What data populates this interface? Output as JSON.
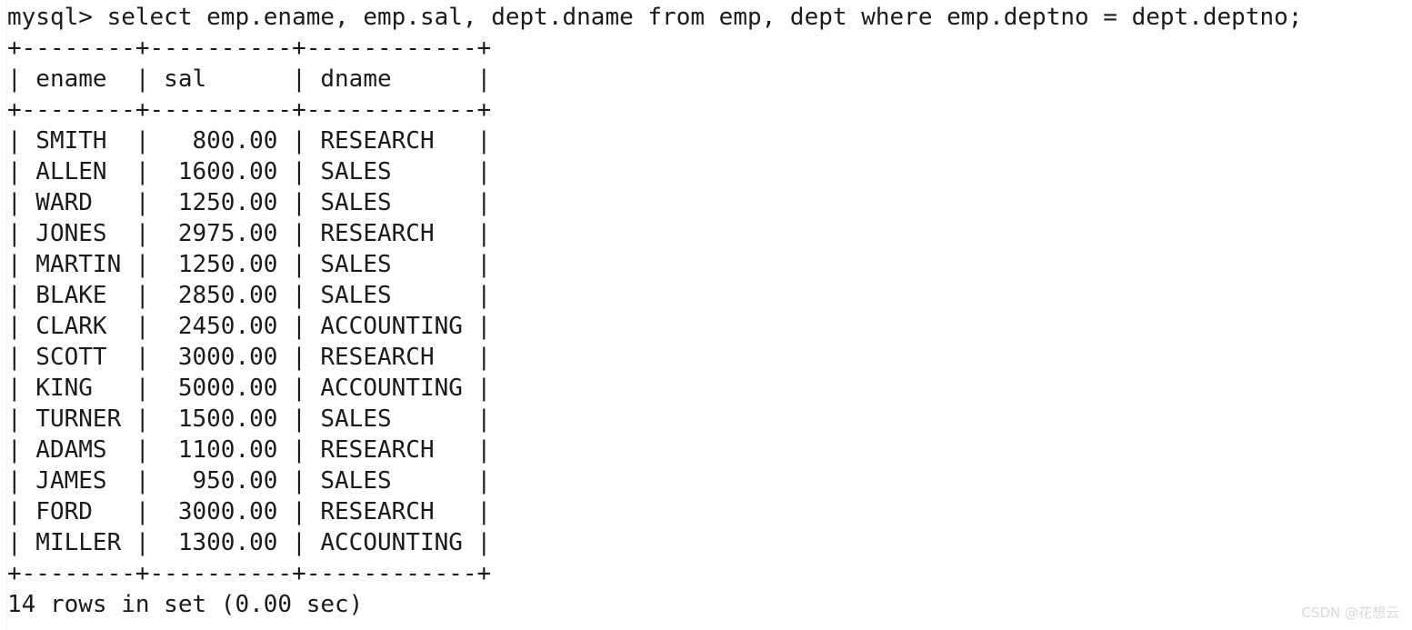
{
  "terminal": {
    "prompt_line": "mysql> select emp.ename, emp.sal, dept.dname from emp, dept where emp.deptno = dept.deptno;",
    "prompt_symbol": "mysql>",
    "query": "select emp.ename, emp.sal, dept.dname from emp, dept where emp.deptno = dept.deptno;",
    "border_top": "+--------+----------+------------+",
    "header_row": "| ename  | sal      | dname      |",
    "border_mid": "+--------+----------+------------+",
    "border_bottom": "+--------+----------+------------+",
    "result_line": "14 rows in set (0.00 sec)",
    "row_count": "14",
    "elapsed": "0.00 sec",
    "columns": [
      "ename",
      "sal",
      "dname"
    ],
    "rows": [
      {
        "line": "| SMITH  |   800.00 | RESEARCH   |",
        "ename": "SMITH",
        "sal": "800.00",
        "dname": "RESEARCH"
      },
      {
        "line": "| ALLEN  |  1600.00 | SALES      |",
        "ename": "ALLEN",
        "sal": "1600.00",
        "dname": "SALES"
      },
      {
        "line": "| WARD   |  1250.00 | SALES      |",
        "ename": "WARD",
        "sal": "1250.00",
        "dname": "SALES"
      },
      {
        "line": "| JONES  |  2975.00 | RESEARCH   |",
        "ename": "JONES",
        "sal": "2975.00",
        "dname": "RESEARCH"
      },
      {
        "line": "| MARTIN |  1250.00 | SALES      |",
        "ename": "MARTIN",
        "sal": "1250.00",
        "dname": "SALES"
      },
      {
        "line": "| BLAKE  |  2850.00 | SALES      |",
        "ename": "BLAKE",
        "sal": "2850.00",
        "dname": "SALES"
      },
      {
        "line": "| CLARK  |  2450.00 | ACCOUNTING |",
        "ename": "CLARK",
        "sal": "2450.00",
        "dname": "ACCOUNTING"
      },
      {
        "line": "| SCOTT  |  3000.00 | RESEARCH   |",
        "ename": "SCOTT",
        "sal": "3000.00",
        "dname": "RESEARCH"
      },
      {
        "line": "| KING   |  5000.00 | ACCOUNTING |",
        "ename": "KING",
        "sal": "5000.00",
        "dname": "ACCOUNTING"
      },
      {
        "line": "| TURNER |  1500.00 | SALES      |",
        "ename": "TURNER",
        "sal": "1500.00",
        "dname": "SALES"
      },
      {
        "line": "| ADAMS  |  1100.00 | RESEARCH   |",
        "ename": "ADAMS",
        "sal": "1100.00",
        "dname": "RESEARCH"
      },
      {
        "line": "| JAMES  |   950.00 | SALES      |",
        "ename": "JAMES",
        "sal": "950.00",
        "dname": "SALES"
      },
      {
        "line": "| FORD   |  3000.00 | RESEARCH   |",
        "ename": "FORD",
        "sal": "3000.00",
        "dname": "RESEARCH"
      },
      {
        "line": "| MILLER |  1300.00 | ACCOUNTING |",
        "ename": "MILLER",
        "sal": "1300.00",
        "dname": "ACCOUNTING"
      }
    ]
  },
  "watermark": {
    "text": "CSDN @花想云",
    "color": "#d8d8d8"
  },
  "colors": {
    "background": "#ffffff",
    "text": "#1b1b1b",
    "watermark": "#d8d8d8"
  }
}
